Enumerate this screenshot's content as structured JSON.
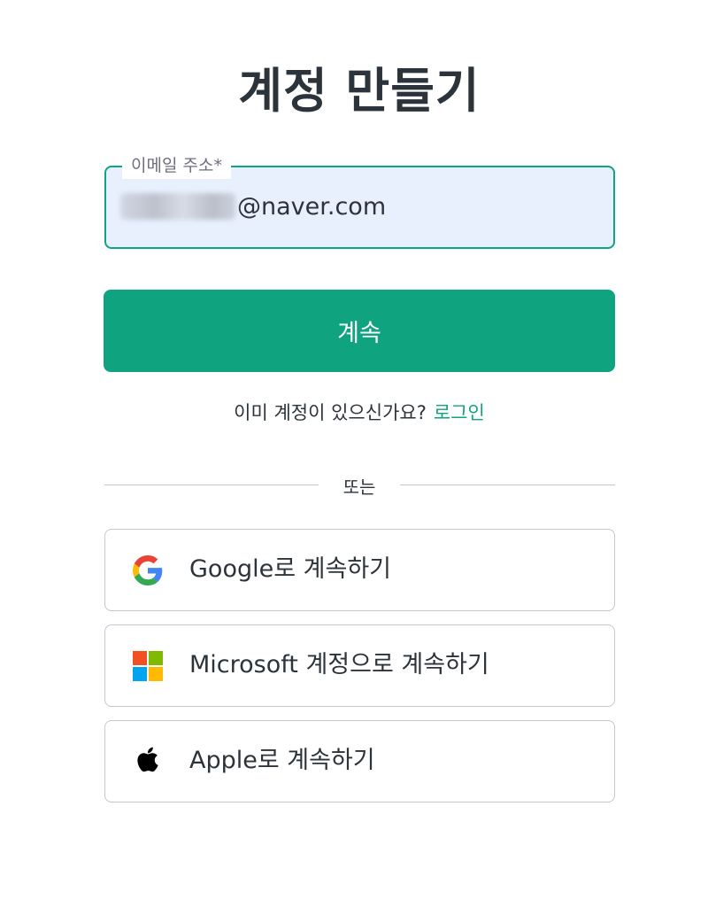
{
  "page": {
    "title": "계정 만들기"
  },
  "email": {
    "label": "이메일 주소*",
    "value_visible": "@naver.com"
  },
  "continue_button": {
    "label": "계속"
  },
  "login_prompt": {
    "text": "이미 계정이 있으신가요?",
    "link_label": "로그인"
  },
  "divider": {
    "text": "또는"
  },
  "social": {
    "google": {
      "label": "Google로 계속하기",
      "icon": "google-icon"
    },
    "microsoft": {
      "label": "Microsoft 계정으로 계속하기",
      "icon": "microsoft-icon"
    },
    "apple": {
      "label": "Apple로 계속하기",
      "icon": "apple-icon"
    }
  },
  "colors": {
    "accent": "#10a37f",
    "text": "#2d333a",
    "input_bg": "#e8f0fe",
    "border": "#c2c8d0"
  }
}
